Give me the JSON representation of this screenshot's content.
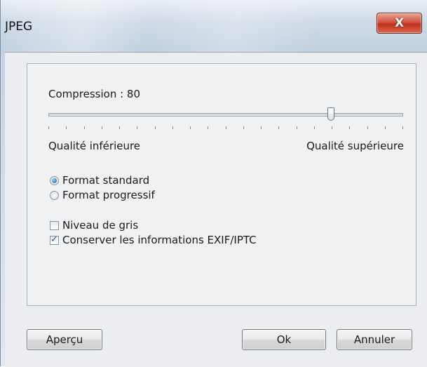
{
  "window": {
    "title": "JPEG",
    "close_glyph": "X"
  },
  "compression": {
    "label": "Compression : 80",
    "value": 80,
    "min": 0,
    "max": 100,
    "low_label": "Qualité inférieure",
    "high_label": "Qualité supérieure"
  },
  "format": {
    "options": [
      {
        "label": "Format standard",
        "selected": true
      },
      {
        "label": "Format progressif",
        "selected": false
      }
    ]
  },
  "options": {
    "grayscale_label": "Niveau de gris",
    "grayscale_checked": false,
    "keep_exif_label": "Conserver les informations EXIF/IPTC",
    "keep_exif_checked": true,
    "check_glyph": "✓"
  },
  "buttons": {
    "preview_label": "Aperçu",
    "ok_label": "Ok",
    "cancel_label": "Annuler"
  },
  "colors": {
    "close_button": "#c0301b",
    "radio_selected": "#2a7fc1",
    "check_mark": "#2b5d91"
  },
  "icons": {
    "close": "close-icon",
    "check": "check-icon"
  }
}
